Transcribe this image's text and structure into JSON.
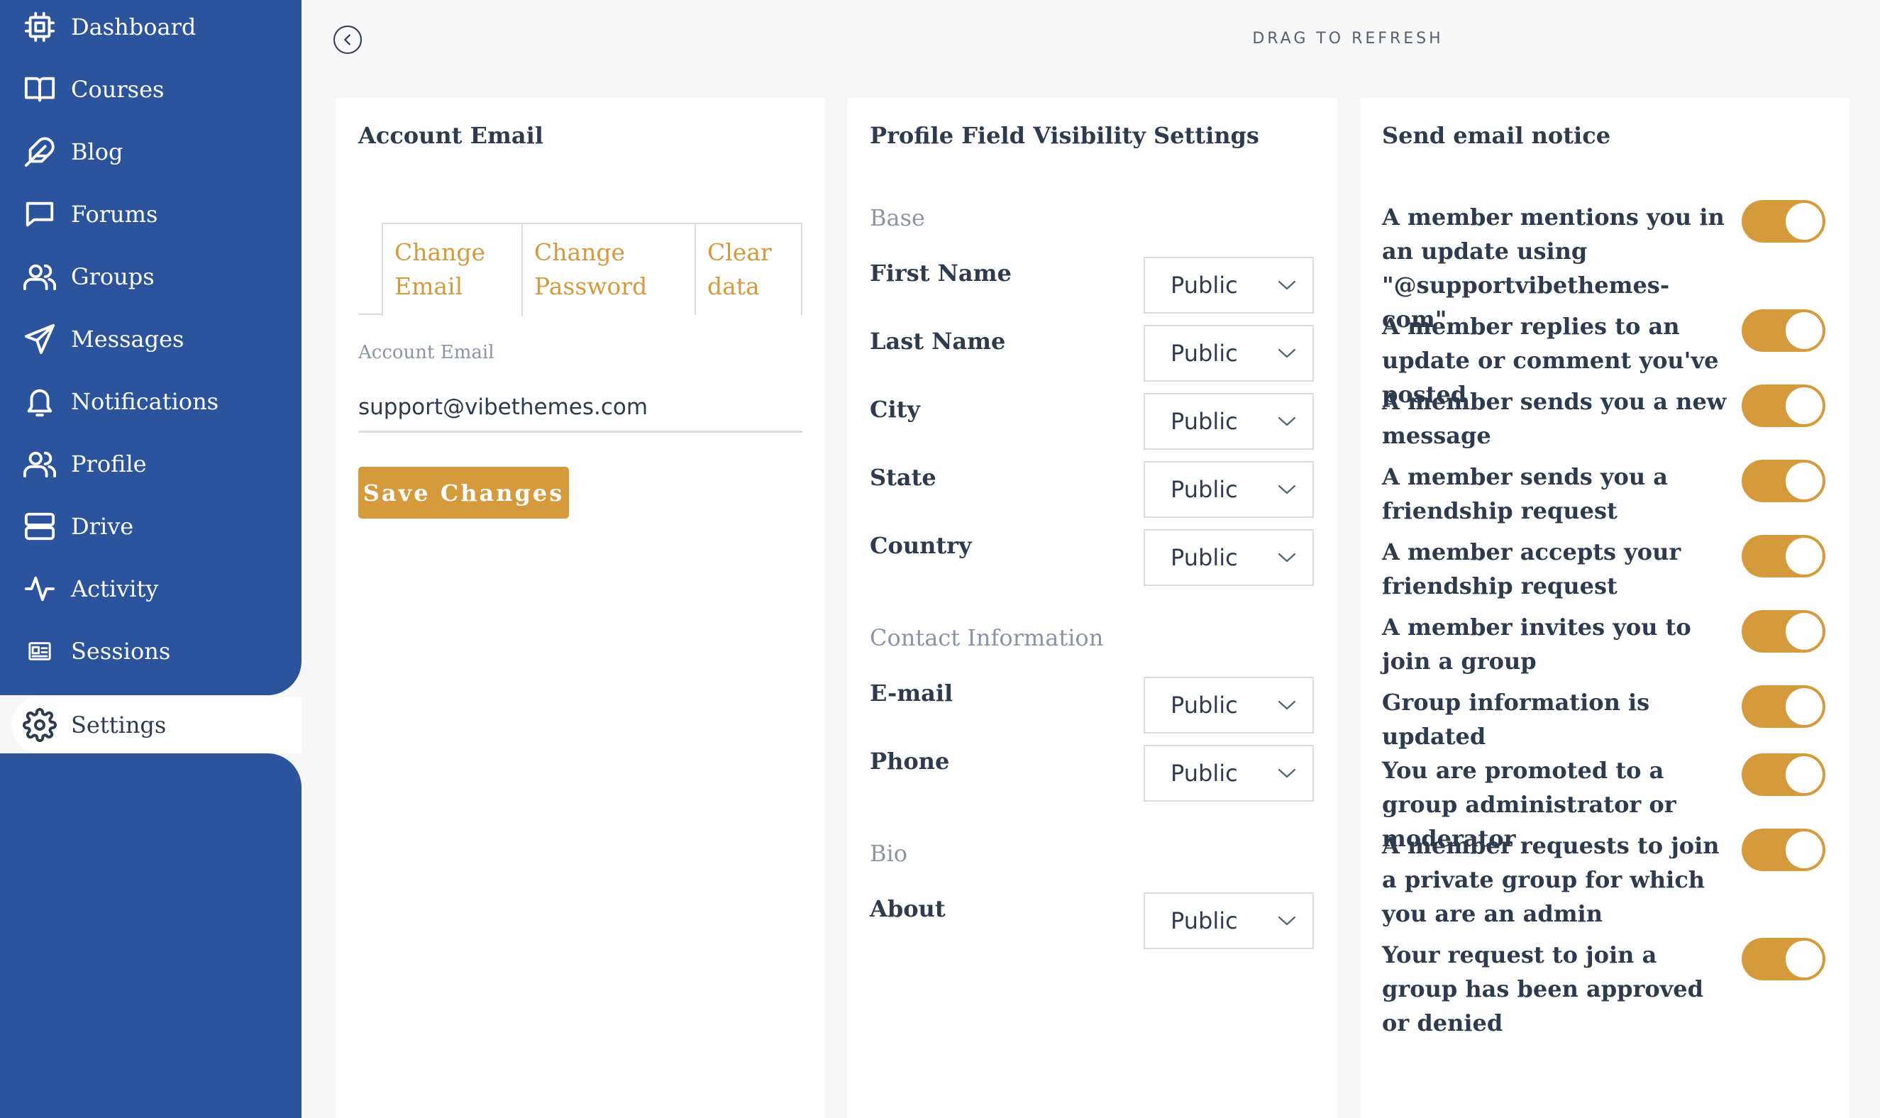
{
  "sidebar": {
    "items": [
      {
        "label": "Dashboard",
        "icon": "chip-icon"
      },
      {
        "label": "Courses",
        "icon": "book-icon"
      },
      {
        "label": "Blog",
        "icon": "feather-icon"
      },
      {
        "label": "Forums",
        "icon": "chat-icon"
      },
      {
        "label": "Groups",
        "icon": "users-icon"
      },
      {
        "label": "Messages",
        "icon": "send-icon"
      },
      {
        "label": "Notifications",
        "icon": "bell-icon"
      },
      {
        "label": "Profile",
        "icon": "users-icon"
      },
      {
        "label": "Drive",
        "icon": "server-icon"
      },
      {
        "label": "Activity",
        "icon": "activity-icon"
      },
      {
        "label": "Sessions",
        "icon": "id-card-icon"
      }
    ],
    "active": {
      "label": "Settings",
      "icon": "gear-icon"
    }
  },
  "topbar": {
    "drag_label": "DRAG TO REFRESH"
  },
  "account_email": {
    "title": "Account Email",
    "tabs": [
      {
        "line1": "Change",
        "line2": "Email"
      },
      {
        "line1": "Change",
        "line2": "Password"
      },
      {
        "line1": "Clear",
        "line2": "data"
      }
    ],
    "field_label": "Account Email",
    "field_value": "support@vibethemes.com",
    "save_label": "Save Changes"
  },
  "visibility": {
    "title": "Profile Field Visibility Settings",
    "sections": [
      {
        "name": "Base",
        "fields": [
          {
            "label": "First Name",
            "value": "Public"
          },
          {
            "label": "Last Name",
            "value": "Public"
          },
          {
            "label": "City",
            "value": "Public"
          },
          {
            "label": "State",
            "value": "Public"
          },
          {
            "label": "Country",
            "value": "Public"
          }
        ]
      },
      {
        "name": "Contact Information",
        "fields": [
          {
            "label": "E-mail",
            "value": "Public"
          },
          {
            "label": "Phone",
            "value": "Public"
          }
        ]
      },
      {
        "name": "Bio",
        "fields": [
          {
            "label": "About",
            "value": "Public"
          }
        ]
      }
    ]
  },
  "email_notice": {
    "title": "Send email notice",
    "items": [
      {
        "text": "A member mentions you in an update using \"@supportvibethemes-com\"",
        "enabled": true
      },
      {
        "text": "A member replies to an update or comment you've posted",
        "enabled": true
      },
      {
        "text": "A member sends you a new message",
        "enabled": true
      },
      {
        "text": "A member sends you a friendship request",
        "enabled": true
      },
      {
        "text": "A member accepts your friendship request",
        "enabled": true
      },
      {
        "text": "A member invites you to join a group",
        "enabled": true
      },
      {
        "text": "Group information is updated",
        "enabled": true
      },
      {
        "text": "You are promoted to a group administrator or moderator",
        "enabled": true
      },
      {
        "text": "A member requests to join a private group for which you are an admin",
        "enabled": true
      },
      {
        "text": "Your request to join a group has been approved or denied",
        "enabled": true
      }
    ]
  },
  "colors": {
    "sidebar": "#2c549c",
    "accent": "#d49a3c",
    "text": "#2e3a4d",
    "muted": "#8a94a4"
  }
}
